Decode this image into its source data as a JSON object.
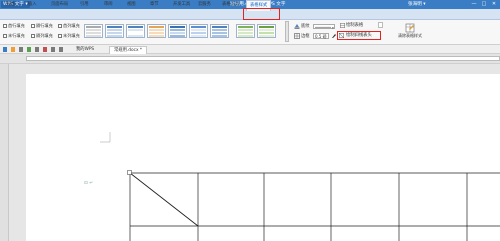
{
  "titlebar": {
    "app_menu": "WPS 文字 ▾",
    "doc_title": "常规用.docx * - WPS 文字",
    "user": "张海明 ▾",
    "win_min": "—",
    "win_max": "□",
    "win_close": "✕"
  },
  "tabs": [
    "开始",
    "插入",
    "页面布局",
    "引用",
    "审阅",
    "视图",
    "章节",
    "开发工具",
    "云服务",
    "表格工具",
    "表格样式"
  ],
  "ribbon": {
    "checks": [
      "首行填充",
      "隔行填充",
      "首列填充",
      "末行填充",
      "隔列填充",
      "末列填充"
    ],
    "shading_label": "底纹",
    "border_label": "边框",
    "line_width": "0.5 磅",
    "draw_table": "绘制表格",
    "draw_diagonal": "绘制斜线表头",
    "clear_style": "清除表格样式"
  },
  "doc_tabs": [
    "我的WPS",
    "常规用.docx *"
  ],
  "colors": {
    "titlebar": "#3b7dc4",
    "highlight": "#e52222",
    "table_style_blue": "#4f81bd",
    "table_style_orange": "#e4a35a",
    "table_style_green": "#7fb05a"
  }
}
